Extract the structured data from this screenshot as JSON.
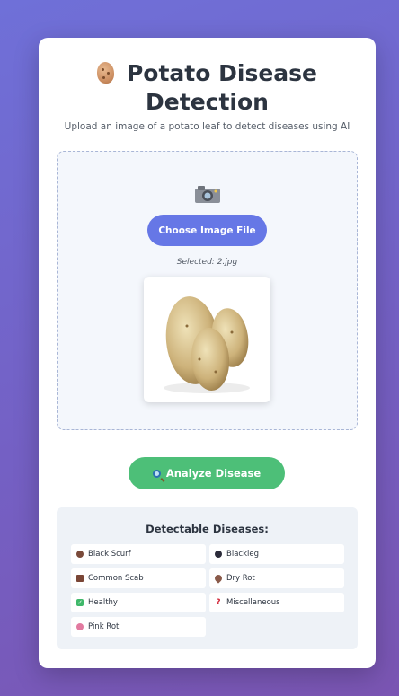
{
  "header": {
    "title_line1": "Potato Disease",
    "title_line2": "Detection",
    "subtitle": "Upload an image of a potato leaf to detect diseases using AI"
  },
  "upload": {
    "choose_label": "Choose Image File",
    "selected_text": "Selected: 2.jpg"
  },
  "analyze_label": "Analyze Disease",
  "diseases": {
    "title": "Detectable Diseases:",
    "items": [
      {
        "label": "Black Scurf",
        "icon": "brown-dot-icon",
        "color": "#7a4a3a"
      },
      {
        "label": "Blackleg",
        "icon": "black-dot-icon",
        "color": "#2b2b3a"
      },
      {
        "label": "Common Scab",
        "icon": "brown-square-icon",
        "color": "#7a4636"
      },
      {
        "label": "Dry Rot",
        "icon": "brown-heart-icon",
        "color": "#8a5a4a"
      },
      {
        "label": "Healthy",
        "icon": "check-icon",
        "color": "#3fb86a"
      },
      {
        "label": "Miscellaneous",
        "icon": "question-icon",
        "color": "#d2283a"
      },
      {
        "label": "Pink Rot",
        "icon": "pink-flower-icon",
        "color": "#e27aa0"
      }
    ]
  }
}
